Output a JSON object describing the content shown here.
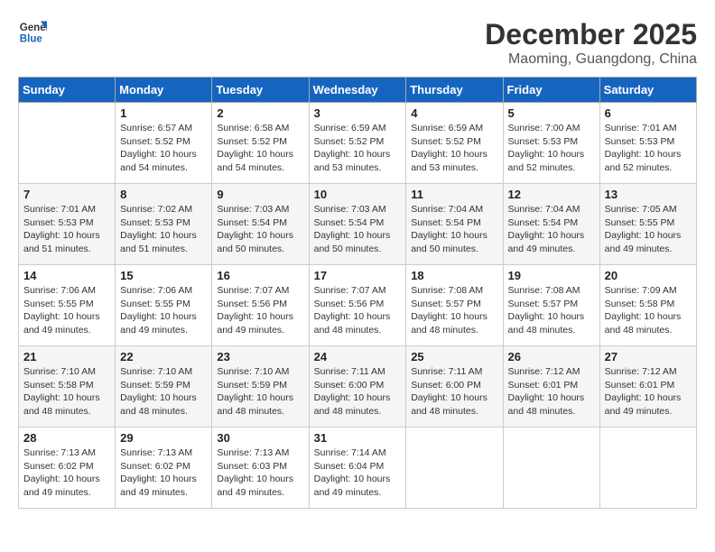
{
  "header": {
    "logo_line1": "General",
    "logo_line2": "Blue",
    "month_year": "December 2025",
    "location": "Maoming, Guangdong, China"
  },
  "days_of_week": [
    "Sunday",
    "Monday",
    "Tuesday",
    "Wednesday",
    "Thursday",
    "Friday",
    "Saturday"
  ],
  "weeks": [
    [
      {
        "day": "",
        "info": ""
      },
      {
        "day": "1",
        "info": "Sunrise: 6:57 AM\nSunset: 5:52 PM\nDaylight: 10 hours\nand 54 minutes."
      },
      {
        "day": "2",
        "info": "Sunrise: 6:58 AM\nSunset: 5:52 PM\nDaylight: 10 hours\nand 54 minutes."
      },
      {
        "day": "3",
        "info": "Sunrise: 6:59 AM\nSunset: 5:52 PM\nDaylight: 10 hours\nand 53 minutes."
      },
      {
        "day": "4",
        "info": "Sunrise: 6:59 AM\nSunset: 5:52 PM\nDaylight: 10 hours\nand 53 minutes."
      },
      {
        "day": "5",
        "info": "Sunrise: 7:00 AM\nSunset: 5:53 PM\nDaylight: 10 hours\nand 52 minutes."
      },
      {
        "day": "6",
        "info": "Sunrise: 7:01 AM\nSunset: 5:53 PM\nDaylight: 10 hours\nand 52 minutes."
      }
    ],
    [
      {
        "day": "7",
        "info": "Sunrise: 7:01 AM\nSunset: 5:53 PM\nDaylight: 10 hours\nand 51 minutes."
      },
      {
        "day": "8",
        "info": "Sunrise: 7:02 AM\nSunset: 5:53 PM\nDaylight: 10 hours\nand 51 minutes."
      },
      {
        "day": "9",
        "info": "Sunrise: 7:03 AM\nSunset: 5:54 PM\nDaylight: 10 hours\nand 50 minutes."
      },
      {
        "day": "10",
        "info": "Sunrise: 7:03 AM\nSunset: 5:54 PM\nDaylight: 10 hours\nand 50 minutes."
      },
      {
        "day": "11",
        "info": "Sunrise: 7:04 AM\nSunset: 5:54 PM\nDaylight: 10 hours\nand 50 minutes."
      },
      {
        "day": "12",
        "info": "Sunrise: 7:04 AM\nSunset: 5:54 PM\nDaylight: 10 hours\nand 49 minutes."
      },
      {
        "day": "13",
        "info": "Sunrise: 7:05 AM\nSunset: 5:55 PM\nDaylight: 10 hours\nand 49 minutes."
      }
    ],
    [
      {
        "day": "14",
        "info": "Sunrise: 7:06 AM\nSunset: 5:55 PM\nDaylight: 10 hours\nand 49 minutes."
      },
      {
        "day": "15",
        "info": "Sunrise: 7:06 AM\nSunset: 5:55 PM\nDaylight: 10 hours\nand 49 minutes."
      },
      {
        "day": "16",
        "info": "Sunrise: 7:07 AM\nSunset: 5:56 PM\nDaylight: 10 hours\nand 49 minutes."
      },
      {
        "day": "17",
        "info": "Sunrise: 7:07 AM\nSunset: 5:56 PM\nDaylight: 10 hours\nand 48 minutes."
      },
      {
        "day": "18",
        "info": "Sunrise: 7:08 AM\nSunset: 5:57 PM\nDaylight: 10 hours\nand 48 minutes."
      },
      {
        "day": "19",
        "info": "Sunrise: 7:08 AM\nSunset: 5:57 PM\nDaylight: 10 hours\nand 48 minutes."
      },
      {
        "day": "20",
        "info": "Sunrise: 7:09 AM\nSunset: 5:58 PM\nDaylight: 10 hours\nand 48 minutes."
      }
    ],
    [
      {
        "day": "21",
        "info": "Sunrise: 7:10 AM\nSunset: 5:58 PM\nDaylight: 10 hours\nand 48 minutes."
      },
      {
        "day": "22",
        "info": "Sunrise: 7:10 AM\nSunset: 5:59 PM\nDaylight: 10 hours\nand 48 minutes."
      },
      {
        "day": "23",
        "info": "Sunrise: 7:10 AM\nSunset: 5:59 PM\nDaylight: 10 hours\nand 48 minutes."
      },
      {
        "day": "24",
        "info": "Sunrise: 7:11 AM\nSunset: 6:00 PM\nDaylight: 10 hours\nand 48 minutes."
      },
      {
        "day": "25",
        "info": "Sunrise: 7:11 AM\nSunset: 6:00 PM\nDaylight: 10 hours\nand 48 minutes."
      },
      {
        "day": "26",
        "info": "Sunrise: 7:12 AM\nSunset: 6:01 PM\nDaylight: 10 hours\nand 48 minutes."
      },
      {
        "day": "27",
        "info": "Sunrise: 7:12 AM\nSunset: 6:01 PM\nDaylight: 10 hours\nand 49 minutes."
      }
    ],
    [
      {
        "day": "28",
        "info": "Sunrise: 7:13 AM\nSunset: 6:02 PM\nDaylight: 10 hours\nand 49 minutes."
      },
      {
        "day": "29",
        "info": "Sunrise: 7:13 AM\nSunset: 6:02 PM\nDaylight: 10 hours\nand 49 minutes."
      },
      {
        "day": "30",
        "info": "Sunrise: 7:13 AM\nSunset: 6:03 PM\nDaylight: 10 hours\nand 49 minutes."
      },
      {
        "day": "31",
        "info": "Sunrise: 7:14 AM\nSunset: 6:04 PM\nDaylight: 10 hours\nand 49 minutes."
      },
      {
        "day": "",
        "info": ""
      },
      {
        "day": "",
        "info": ""
      },
      {
        "day": "",
        "info": ""
      }
    ]
  ]
}
